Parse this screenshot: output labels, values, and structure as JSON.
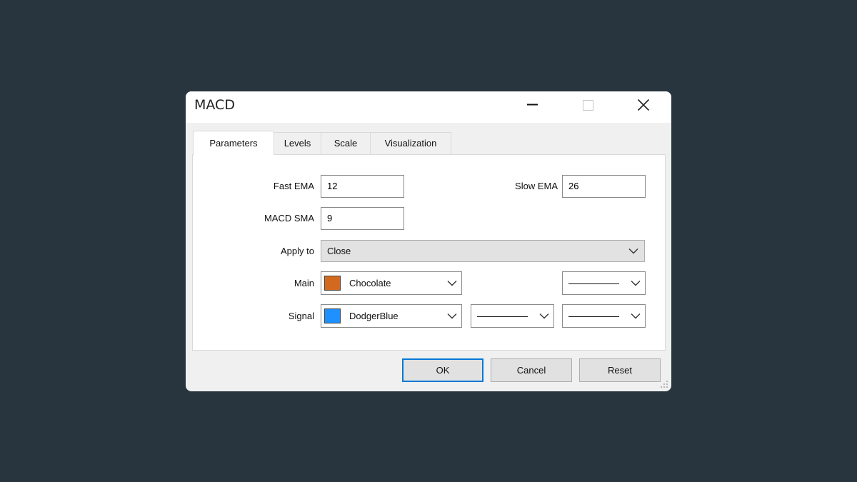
{
  "window": {
    "title": "MACD"
  },
  "tabs": [
    {
      "label": "Parameters",
      "active": true
    },
    {
      "label": "Levels",
      "active": false
    },
    {
      "label": "Scale",
      "active": false
    },
    {
      "label": "Visualization",
      "active": false
    }
  ],
  "params": {
    "fast_ema": {
      "label": "Fast EMA",
      "value": "12"
    },
    "slow_ema": {
      "label": "Slow EMA",
      "value": "26"
    },
    "macd_sma": {
      "label": "MACD SMA",
      "value": "9"
    },
    "apply_to": {
      "label": "Apply to",
      "value": "Close"
    },
    "main": {
      "label": "Main",
      "color_name": "Chocolate",
      "color": "#d2691e"
    },
    "signal": {
      "label": "Signal",
      "color_name": "DodgerBlue",
      "color": "#1e90ff"
    }
  },
  "buttons": {
    "ok": "OK",
    "cancel": "Cancel",
    "reset": "Reset"
  },
  "colors": {
    "backdrop": "#29353e",
    "focus_border": "#0078d7"
  }
}
